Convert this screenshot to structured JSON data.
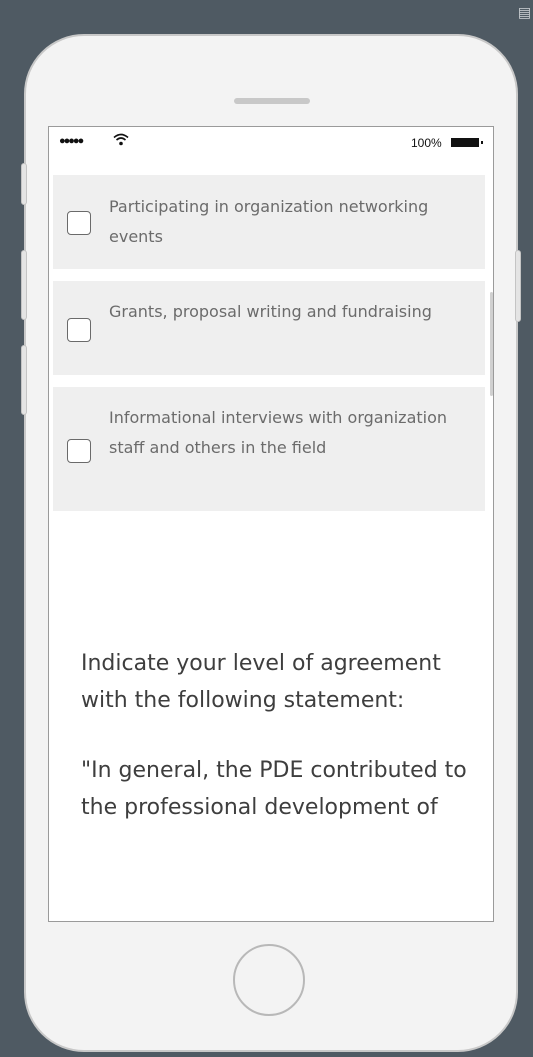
{
  "status_bar": {
    "signal": "●●●●●",
    "wifi": "wifi-icon",
    "battery_text": "100%"
  },
  "options": [
    {
      "label": "Participating in organization networking events",
      "checked": false
    },
    {
      "label": "Grants, proposal writing and fundraising",
      "checked": false
    },
    {
      "label": "Informational interviews with organization staff and others in the field",
      "checked": false
    }
  ],
  "question": {
    "prompt": "Indicate your level of agreement with the following statement:",
    "statement": "\"In general, the PDE contributed to the professional development of"
  },
  "colors": {
    "background": "#4f5a63",
    "phone_body": "#f3f3f3",
    "option_background": "#efefef",
    "text": "#3e3e3e"
  }
}
